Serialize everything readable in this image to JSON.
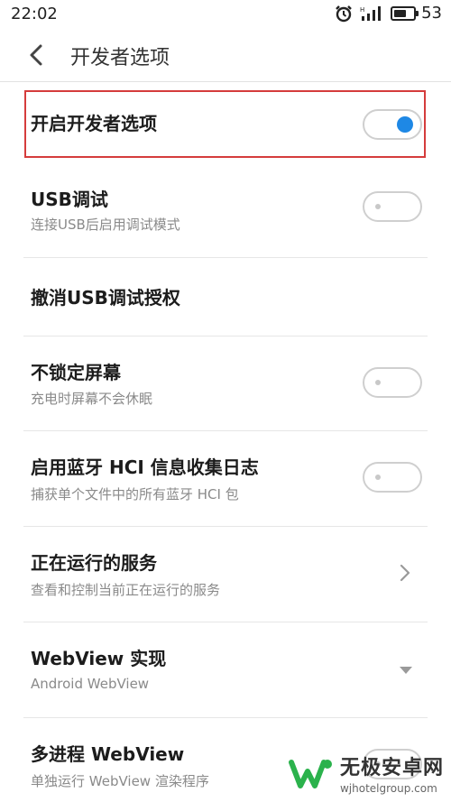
{
  "status_bar": {
    "time": "22:02",
    "battery_level": "53",
    "battery_fraction": 0.53,
    "icons": [
      "alarm-icon",
      "signal-icon",
      "battery-icon"
    ]
  },
  "header": {
    "title": "开发者选项",
    "back_icon": "chevron-left-icon"
  },
  "settings": {
    "items": [
      {
        "title": "开启开发者选项",
        "subtitle": "",
        "control": "toggle",
        "state": "on",
        "highlighted": true
      },
      {
        "title": "USB调试",
        "subtitle": "连接USB后启用调试模式",
        "control": "toggle",
        "state": "off"
      },
      {
        "title": "撤消USB调试授权",
        "subtitle": "",
        "control": "none"
      },
      {
        "title": "不锁定屏幕",
        "subtitle": "充电时屏幕不会休眠",
        "control": "toggle",
        "state": "off"
      },
      {
        "title": "启用蓝牙 HCI 信息收集日志",
        "subtitle": "捕获单个文件中的所有蓝牙 HCI 包",
        "control": "toggle",
        "state": "off"
      },
      {
        "title": "正在运行的服务",
        "subtitle": "查看和控制当前正在运行的服务",
        "control": "chevron"
      },
      {
        "title": "WebView 实现",
        "subtitle": "Android WebView",
        "control": "dropdown"
      },
      {
        "title": "多进程 WebView",
        "subtitle": "单独运行 WebView 渲染程序",
        "control": "toggle",
        "state": "off"
      }
    ]
  },
  "watermark": {
    "name": "无极安卓网",
    "url": "wjhotelgroup.com"
  },
  "colors": {
    "accent": "#1e88e5",
    "highlight_border": "#d53c3c",
    "watermark_green": "#2bb24c"
  }
}
